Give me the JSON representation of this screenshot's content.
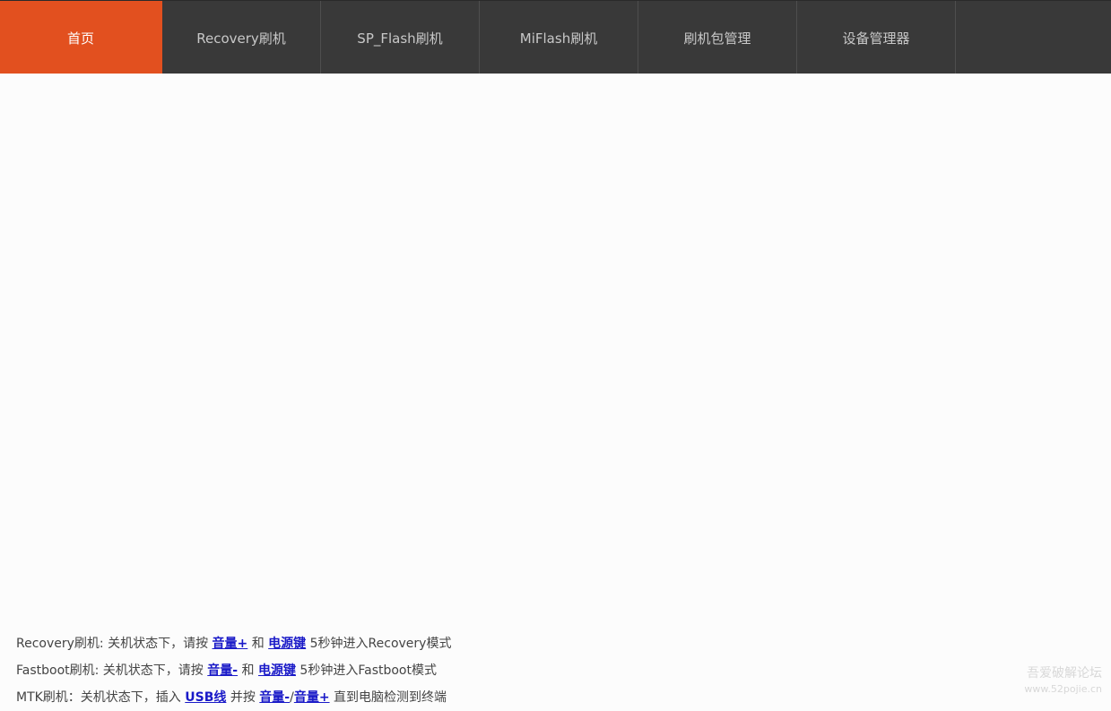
{
  "nav": {
    "tabs": [
      {
        "label": "首页"
      },
      {
        "label": "Recovery刷机"
      },
      {
        "label": "SP_Flash刷机"
      },
      {
        "label": "MiFlash刷机"
      },
      {
        "label": "刷机包管理"
      },
      {
        "label": "设备管理器"
      }
    ],
    "active_color": "#e2501f",
    "bar_color": "#393939"
  },
  "instructions": {
    "recovery": {
      "prefix": "Recovery刷机: 关机状态下，请按 ",
      "key1": "音量+",
      "mid": " 和 ",
      "key2": "电源键",
      "suffix": " 5秒钟进入Recovery模式"
    },
    "fastboot": {
      "prefix": "Fastboot刷机: 关机状态下，请按 ",
      "key1": "音量-",
      "mid": " 和 ",
      "key2": "电源键",
      "suffix": " 5秒钟进入Fastboot模式"
    },
    "mtk": {
      "prefix": "MTK刷机：关机状态下，插入 ",
      "usb": "USB线",
      "mid": " 并按 ",
      "key1": "音量-",
      "slash": "/",
      "key2": "音量+",
      "suffix": " 直到电脑检测到终端"
    }
  },
  "watermark": {
    "title": "吾爱破解论坛",
    "url": "www.52pojie.cn"
  }
}
